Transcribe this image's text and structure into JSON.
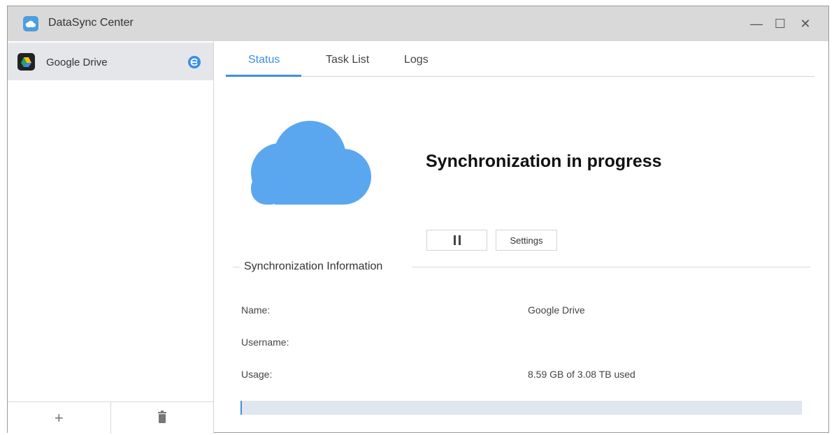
{
  "window": {
    "title": "DataSync Center"
  },
  "title_controls": {
    "minimize": "—",
    "maximize": "☐",
    "close": "✕"
  },
  "sidebar": {
    "items": [
      {
        "label": "Google Drive",
        "icon": "google-drive-icon"
      }
    ],
    "footer": {
      "add": "+",
      "delete_icon": "trash-icon"
    }
  },
  "tabs": [
    {
      "label": "Status"
    },
    {
      "label": "Task List"
    },
    {
      "label": "Logs"
    }
  ],
  "status": {
    "heading": "Synchronization in progress",
    "settings_label": "Settings"
  },
  "info": {
    "section_title": "Synchronization Information",
    "name_label": "Name:",
    "name_value": "Google Drive",
    "username_label": "Username:",
    "username_value": "",
    "usage_label": "Usage:",
    "usage_value": "8.59 GB of 3.08 TB used",
    "usage_fraction": 0.0028
  },
  "colors": {
    "accent": "#3d8fe3",
    "cloud": "#5aa7ef",
    "titlebar": "#d9d9d9"
  }
}
